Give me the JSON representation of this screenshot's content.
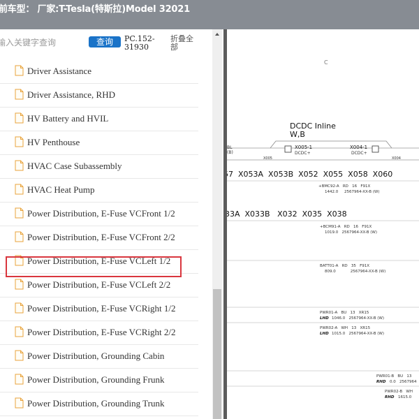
{
  "header": {
    "title": "前车型： 厂家:T-Tesla(特斯拉)Model 32021"
  },
  "sidebar": {
    "search_placeholder": "输入关键字查询",
    "search_button": "查询",
    "pc_code": "PC.152-31930",
    "collapse_all": "折叠全部",
    "items": [
      {
        "label": "Driver Assistance"
      },
      {
        "label": "Driver Assistance, RHD"
      },
      {
        "label": "HV Battery and HVIL"
      },
      {
        "label": "HV Penthouse"
      },
      {
        "label": "HVAC Case Subassembly"
      },
      {
        "label": "HVAC Heat Pump"
      },
      {
        "label": "Power Distribution, E-Fuse VCFront 1/2"
      },
      {
        "label": "Power Distribution, E-Fuse VCFront 2/2"
      },
      {
        "label": "Power Distribution, E-Fuse VCLeft 1/2"
      },
      {
        "label": "Power Distribution, E-Fuse VCLeft 2/2"
      },
      {
        "label": "Power Distribution, E-Fuse VCRight 1/2"
      },
      {
        "label": "Power Distribution, E-Fuse VCRight 2/2"
      },
      {
        "label": "Power Distribution, Grounding Cabin"
      },
      {
        "label": "Power Distribution, Grounding Frunk"
      },
      {
        "label": "Power Distribution, Grounding Trunk"
      }
    ],
    "selected_item": "Power Distribution, E-Fuse VCFront 2/2"
  },
  "diagram": {
    "grid_col": "C",
    "block_title_1": "DCDC Inline",
    "block_title_2": "W,B",
    "conn_left_a": "X005-1",
    "conn_left_b": "DCDC+",
    "conn_right_a": "X004-1",
    "conn_right_b": "DCDC+",
    "small_left": "X005",
    "small_right": "X004",
    "edge_bl": "BL",
    "edge_b": "(B)",
    "row1_connectors": "57  X053A  X053B  X052  X055  X058  X060",
    "row1_wire": "+BMC92-A   RD   16   F91X",
    "row1_part": "1442.0     2567964-XX-B (W)",
    "row2_connectors": "33A  X033B   X032  X035  X038",
    "row2_wire": "+BCM91-A   RD   16   F91X",
    "row2_part": "1019.0   2567964-XX-B (W)",
    "batt_wire": "BATT01-A   RD   35   F91X",
    "batt_part": "809.0            2567964-XX-B (W)",
    "pwr1_wire": "PWR01-A   BU   13   XR15",
    "pwr1_tag": "LHD",
    "pwr1_part": "1046.0   2567964-XX-B (W)",
    "pwr2_wire": "PWR02-A   WH   13   XR15",
    "pwr2_tag": "LHD",
    "pwr2_part": "1015.0   2567964-XX-B (W)",
    "pwr3_wire": "PWR01-B   BU   13",
    "pwr3_tag": "RHD",
    "pwr3_part": "0.0   2567964",
    "pwr4_wire": "PWR02-B   WH",
    "pwr4_tag": "RHD",
    "pwr4_part": "1615.0"
  }
}
